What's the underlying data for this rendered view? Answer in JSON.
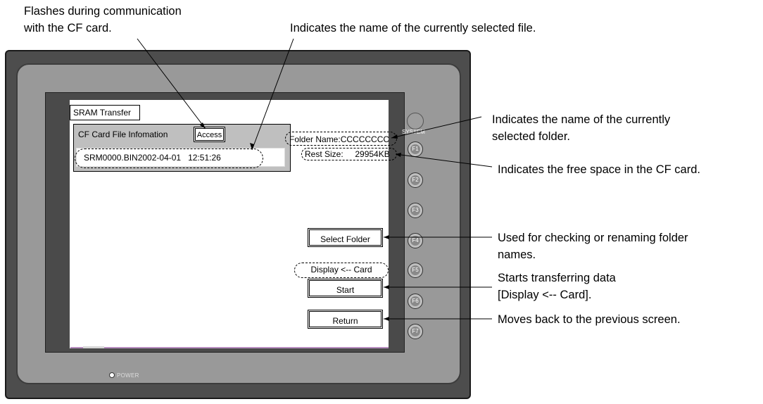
{
  "annotations": {
    "cf_flash_line1": "Flashes during communication",
    "cf_flash_line2": "with the CF card.",
    "file_name": "Indicates the name of the currently selected file.",
    "folder_line1": "Indicates the name of the currently",
    "folder_line2": "selected folder.",
    "free_space": "Indicates the free space in the CF card.",
    "select_line1": "Used for checking or renaming folder",
    "select_line2": "names.",
    "start_line1": "Starts transferring data",
    "start_line2": "[Display <-- Card].",
    "return": "Moves back to the previous screen."
  },
  "screen": {
    "title": "SRAM Transfer",
    "cf_label": "CF Card File Infomation",
    "access_label": "Access",
    "file_entry": "SRM0000.BIN2002-04-01   12:51:26",
    "folder_name": "Folder Name:CCCCCCCC",
    "rest_size": "Rest Size:     29954KB",
    "direction": "Display <-- Card",
    "select_folder_label": "Select Folder",
    "start_label": "Start",
    "return_label": "Return"
  },
  "device": {
    "system_label": "SYSTEM",
    "fkeys": [
      "F1",
      "F2",
      "F3",
      "F4",
      "F5",
      "F6",
      "F7"
    ],
    "power_label": "POWER"
  }
}
